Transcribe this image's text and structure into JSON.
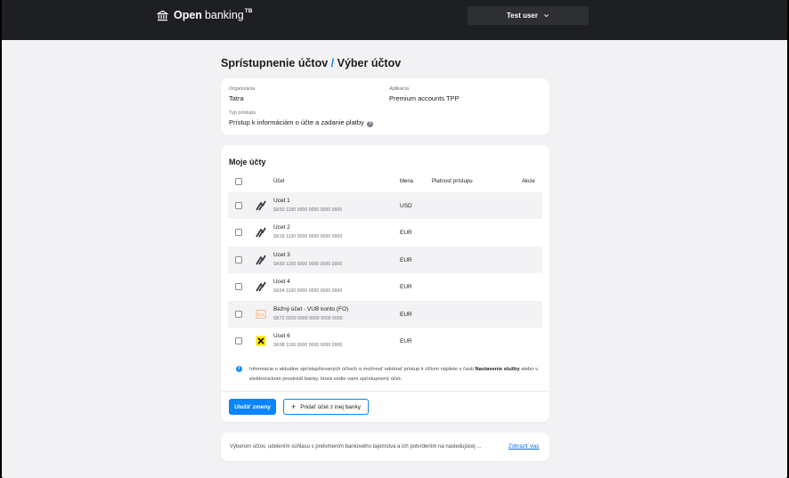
{
  "header": {
    "logo_strong": "Open",
    "logo_light": "banking",
    "logo_sup": "TB",
    "user_label": "Test user"
  },
  "page": {
    "title_part1": "Sprístupnenie účtov",
    "title_sep": "/",
    "title_part2": "Výber účtov"
  },
  "info": {
    "org_label": "Organizácia",
    "org_value": "Tatra",
    "app_label": "Aplikácia",
    "app_value": "Premium accounts TPP",
    "access_label": "Typ prístupu",
    "access_value": "Prístup k informáciám o účte a zadanie platby",
    "help_glyph": "?"
  },
  "accounts": {
    "title": "Moje účty",
    "columns": {
      "account": "Účet",
      "currency": "Mena",
      "validity": "Platnosť prístupu",
      "actions": "Akcie"
    },
    "rows": [
      {
        "name": "Ucet 1",
        "iban": "SK50 1100 0000 0000 0000 0000",
        "currency": "USD",
        "icon": "tatra-bank-icon"
      },
      {
        "name": "Ucet 2",
        "iban": "SK18 1100 0000 0000 0000 0000",
        "currency": "EUR",
        "icon": "tatra-bank-icon"
      },
      {
        "name": "Ucet 3",
        "iban": "SK60 1100 0000 0000 0000 0000",
        "currency": "EUR",
        "icon": "tatra-bank-icon"
      },
      {
        "name": "Ucet 4",
        "iban": "SK94 1100 0000 0000 0000 0000",
        "currency": "EUR",
        "icon": "tatra-bank-icon"
      },
      {
        "name": "Bežný účet - VUB konto (FO)",
        "iban": "SK72 0200 0000 0000 0000 0000",
        "currency": "EUR",
        "icon": "vub-bank-icon"
      },
      {
        "name": "Ucet 6",
        "iban": "SK98 1100 0000 0000 0000 0000",
        "currency": "EUR",
        "icon": "raiffeisen-bank-icon"
      }
    ],
    "notice_glyph": "i",
    "notice_pre": "Informácie o aktuálne sprístupňovaných účtoch a možnosť odobrať prístup k účtom nájdete v časti ",
    "notice_bold": "Nastavenie služby",
    "notice_post": " alebo v elektronickom prostredí banky, ktorá vedie vami sprístupnený účet.",
    "save_label": "Uložiť zmeny",
    "add_label": "Pridať účet z inej banky",
    "add_glyph": "+"
  },
  "consent": {
    "text": "Výberom účtov, udelením súhlasu s prelomením bankového tajomstva a ich potvrdením na nasledujúcej ...",
    "link": "Zobraziť viac"
  },
  "colors": {
    "accent": "#0a84ff",
    "topbar": "#1e1f22",
    "background": "#f2f2f4"
  }
}
